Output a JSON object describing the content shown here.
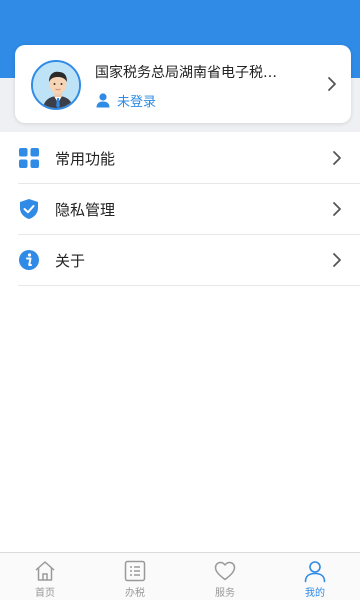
{
  "profile": {
    "org_name": "国家税务总局湖南省电子税…",
    "login_status": "未登录"
  },
  "menu": {
    "items": [
      {
        "label": "常用功能",
        "icon": "grid-icon"
      },
      {
        "label": "隐私管理",
        "icon": "shield-check-icon"
      },
      {
        "label": "关于",
        "icon": "info-icon"
      }
    ]
  },
  "tabbar": {
    "tabs": [
      {
        "label": "首页",
        "icon": "home-icon",
        "active": false
      },
      {
        "label": "办税",
        "icon": "list-icon",
        "active": false
      },
      {
        "label": "服务",
        "icon": "heart-icon",
        "active": false
      },
      {
        "label": "我的",
        "icon": "user-icon",
        "active": true
      }
    ]
  },
  "colors": {
    "accent": "#2f8be6",
    "inactive": "#999999",
    "background_band": "#eef0f3"
  }
}
